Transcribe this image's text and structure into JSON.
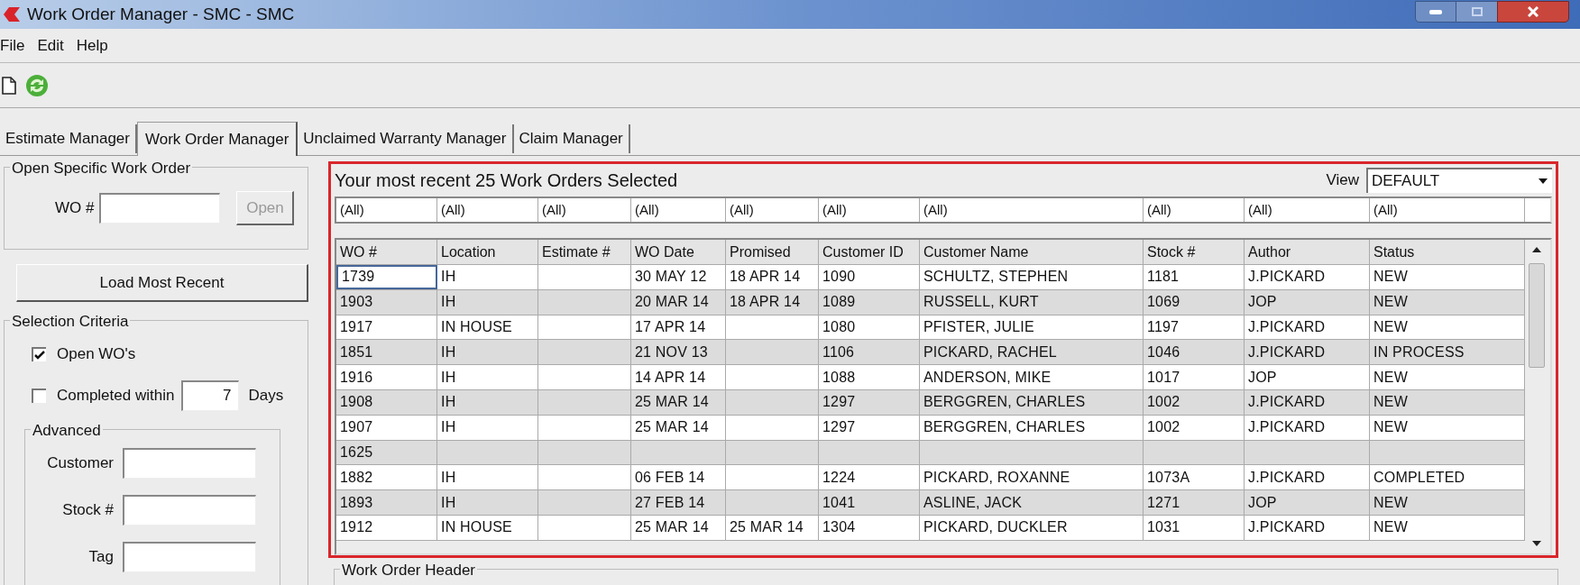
{
  "window": {
    "title": "Work Order Manager - SMC - SMC"
  },
  "menu": [
    {
      "label": "File"
    },
    {
      "label": "Edit"
    },
    {
      "label": "Help"
    }
  ],
  "tabs": [
    {
      "label": "Estimate Manager",
      "selected": false
    },
    {
      "label": "Work Order Manager",
      "selected": true
    },
    {
      "label": "Unclaimed Warranty Manager",
      "selected": false
    },
    {
      "label": "Claim Manager",
      "selected": false
    }
  ],
  "open_specific": {
    "title": "Open Specific Work Order",
    "wo_label": "WO #",
    "open_button": {
      "label": "Open",
      "disabled": true
    }
  },
  "load_button": "Load Most Recent",
  "selection_criteria": {
    "title": "Selection Criteria",
    "open_wos": {
      "label": "Open WO's",
      "checked": true
    },
    "completed": {
      "label": "Completed within",
      "checked": false,
      "days": "7",
      "unit": "Days"
    },
    "advanced": {
      "title": "Advanced",
      "fields": [
        {
          "label": "Customer"
        },
        {
          "label": "Stock #"
        },
        {
          "label": "Tag"
        }
      ]
    }
  },
  "results": {
    "title": "Your most recent 25 Work Orders Selected",
    "view_label": "View",
    "view_value": "DEFAULT",
    "filters": [
      "(All)",
      "(All)",
      "(All)",
      "(All)",
      "(All)",
      "(All)",
      "(All)",
      "(All)",
      "(All)",
      "(All)"
    ],
    "columns": [
      "WO #",
      "Location",
      "Estimate #",
      "WO Date",
      "Promised",
      "Customer ID",
      "Customer Name",
      "Stock #",
      "Author",
      "Status"
    ],
    "rows": [
      {
        "selected": true,
        "cells": [
          "1739",
          "IH",
          "",
          "30 MAY 12",
          "18 APR 14",
          "1090",
          "SCHULTZ, STEPHEN",
          "1181",
          "J.PICKARD",
          "NEW"
        ]
      },
      {
        "selected": false,
        "cells": [
          "1903",
          "IH",
          "",
          "20 MAR 14",
          "18 APR 14",
          "1089",
          "RUSSELL, KURT",
          "1069",
          "JOP",
          "NEW"
        ]
      },
      {
        "selected": false,
        "cells": [
          "1917",
          "IN HOUSE",
          "",
          "17 APR 14",
          "",
          "1080",
          "PFISTER, JULIE",
          "1197",
          "J.PICKARD",
          "NEW"
        ]
      },
      {
        "selected": false,
        "cells": [
          "1851",
          "IH",
          "",
          "21 NOV 13",
          "",
          "1106",
          "PICKARD, RACHEL",
          "1046",
          "J.PICKARD",
          "IN PROCESS"
        ]
      },
      {
        "selected": false,
        "cells": [
          "1916",
          "IH",
          "",
          "14 APR 14",
          "",
          "1088",
          "ANDERSON, MIKE",
          "1017",
          "JOP",
          "NEW"
        ]
      },
      {
        "selected": false,
        "cells": [
          "1908",
          "IH",
          "",
          "25 MAR 14",
          "",
          "1297",
          "BERGGREN, CHARLES",
          "1002",
          "J.PICKARD",
          "NEW"
        ]
      },
      {
        "selected": false,
        "cells": [
          "1907",
          "IH",
          "",
          "25 MAR 14",
          "",
          "1297",
          "BERGGREN, CHARLES",
          "1002",
          "J.PICKARD",
          "NEW"
        ]
      },
      {
        "selected": false,
        "cells": [
          "1625",
          "",
          "",
          "",
          "",
          "",
          "",
          "",
          "",
          ""
        ]
      },
      {
        "selected": false,
        "cells": [
          "1882",
          "IH",
          "",
          "06 FEB 14",
          "",
          "1224",
          "PICKARD, ROXANNE",
          "1073A",
          "J.PICKARD",
          "COMPLETED"
        ]
      },
      {
        "selected": false,
        "cells": [
          "1893",
          "IH",
          "",
          "27 FEB 14",
          "",
          "1041",
          "ASLINE, JACK",
          "1271",
          "JOP",
          "NEW"
        ]
      },
      {
        "selected": false,
        "cells": [
          "1912",
          "IN HOUSE",
          "",
          "25 MAR 14",
          "25 MAR 14",
          "1304",
          "PICKARD, DUCKLER",
          "1031",
          "J.PICKARD",
          "NEW"
        ]
      }
    ]
  },
  "work_order_header": {
    "title": "Work Order Header"
  }
}
